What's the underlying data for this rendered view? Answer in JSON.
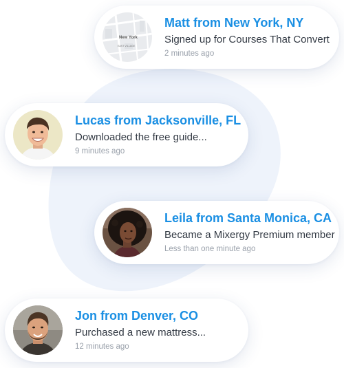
{
  "notifications": [
    {
      "title": "Matt from New York, NY",
      "action": "Signed up for Courses That Convert",
      "time": "2 minutes ago",
      "avatar": "map-thumbnail",
      "map_labels": {
        "city": "New York",
        "area": "EAST VILLAGE"
      }
    },
    {
      "title": "Lucas from Jacksonville, FL",
      "action": "Downloaded the free guide...",
      "time": "9 minutes ago",
      "avatar": "user-photo"
    },
    {
      "title": "Leila from Santa Monica, CA",
      "action": "Became a Mixergy Premium member",
      "time": "Less than one minute ago",
      "avatar": "user-photo"
    },
    {
      "title": "Jon from Denver, CO",
      "action": "Purchased a new mattress...",
      "time": "12 minutes ago",
      "avatar": "user-photo"
    }
  ],
  "colors": {
    "title": "#1a8fe3",
    "action": "#333a44",
    "time": "#9aa1ab",
    "background_shape": "#eef3fb"
  }
}
